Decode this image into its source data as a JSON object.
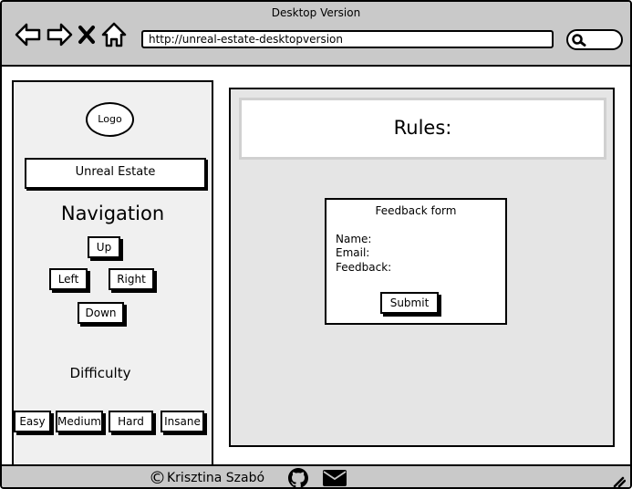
{
  "window": {
    "title": "Desktop Version"
  },
  "toolbar": {
    "url": "http://unreal-estate-desktopversion",
    "icons": [
      "back-arrow-icon",
      "forward-arrow-icon",
      "close-icon",
      "home-icon",
      "search-icon"
    ]
  },
  "sidebar": {
    "logo": "Logo",
    "site_name": "Unreal Estate",
    "navigation": {
      "title": "Navigation",
      "up": "Up",
      "left": "Left",
      "right": "Right",
      "down": "Down"
    },
    "difficulty": {
      "title": "Difficulty",
      "options": [
        "Easy",
        "Medium",
        "Hard",
        "Insane"
      ]
    }
  },
  "main": {
    "rules_title": "Rules:",
    "feedback": {
      "title": "Feedback form",
      "name_label": "Name:",
      "email_label": "Email:",
      "feedback_label": "Feedback:",
      "submit": "Submit"
    }
  },
  "footer": {
    "copyright_symbol": "©",
    "author": "Krisztina Szabó",
    "icons": [
      "github-icon",
      "mail-icon"
    ]
  }
}
